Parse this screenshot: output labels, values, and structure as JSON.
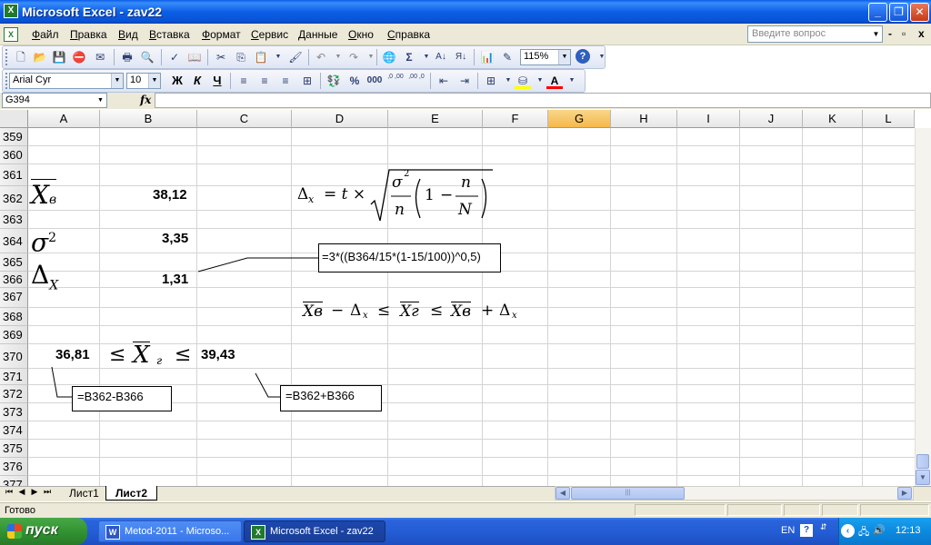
{
  "window": {
    "title": "Microsoft Excel - zav22",
    "app_icon": "X"
  },
  "menu": {
    "items": [
      "Файл",
      "Правка",
      "Вид",
      "Вставка",
      "Формат",
      "Сервис",
      "Данные",
      "Окно",
      "Справка"
    ],
    "help_placeholder": "Введите вопрос"
  },
  "toolbar": {
    "zoom": "115%",
    "font": "Arial Cyr",
    "size": "10",
    "bold": "Ж",
    "italic": "К",
    "underline": "Ч",
    "percent": "%",
    "thousands": "000",
    "inc_dec": ",0 ,00",
    "dec_dec": ",00 ,0"
  },
  "formula_bar": {
    "name_box": "G394",
    "fx": "fx"
  },
  "grid": {
    "columns": [
      "A",
      "B",
      "C",
      "D",
      "E",
      "F",
      "G",
      "H",
      "I",
      "J",
      "K",
      "L"
    ],
    "selected_column": "G",
    "rows": [
      "359",
      "360",
      "361",
      "362",
      "363",
      "364",
      "365",
      "366",
      "367",
      "368",
      "369",
      "370",
      "371",
      "372",
      "373",
      "374",
      "375",
      "376",
      "377"
    ]
  },
  "cells": {
    "b362": "38,12",
    "b364": "3,35",
    "b366": "1,31",
    "a370": "36,81",
    "c370": "39,43"
  },
  "notes": {
    "n1": "=3*((B364/15*(1-15/100))^0,5)",
    "n2": "=B362-B366",
    "n3": "=B362+B366"
  },
  "math": {
    "xbar": "X",
    "xbar_sub": "в",
    "sigma": "σ",
    "sigma_sup": "2",
    "delta": "Δ",
    "delta_sub": "X",
    "f_lhs": "Δ",
    "f_lhs_sub": "x",
    "f_eq": "= t ×",
    "f_sig": "σ",
    "f_sig_sup": "2",
    "f_n": "n",
    "f_one": "1",
    "f_minus": "−",
    "f_n2": "n",
    "f_N": "N",
    "ineq_xv": "Xв",
    "ineq_minus": "−",
    "ineq_delta": "Δ",
    "ineq_sub": "x",
    "ineq_le": "≤",
    "ineq_xg": "Xг",
    "ineq_plus": "+",
    "r370_le1": "≤",
    "r370_x": "X",
    "r370_sub": "г",
    "r370_le2": "≤"
  },
  "sheets": {
    "tabs": [
      "Лист1",
      "Лист2"
    ],
    "active": "Лист2"
  },
  "status": {
    "text": "Готово"
  },
  "taskbar": {
    "start": "пуск",
    "tasks": [
      "Metod-2011 - Microso...",
      "Microsoft Excel - zav22"
    ],
    "lang": "EN",
    "clock": "12:13"
  }
}
